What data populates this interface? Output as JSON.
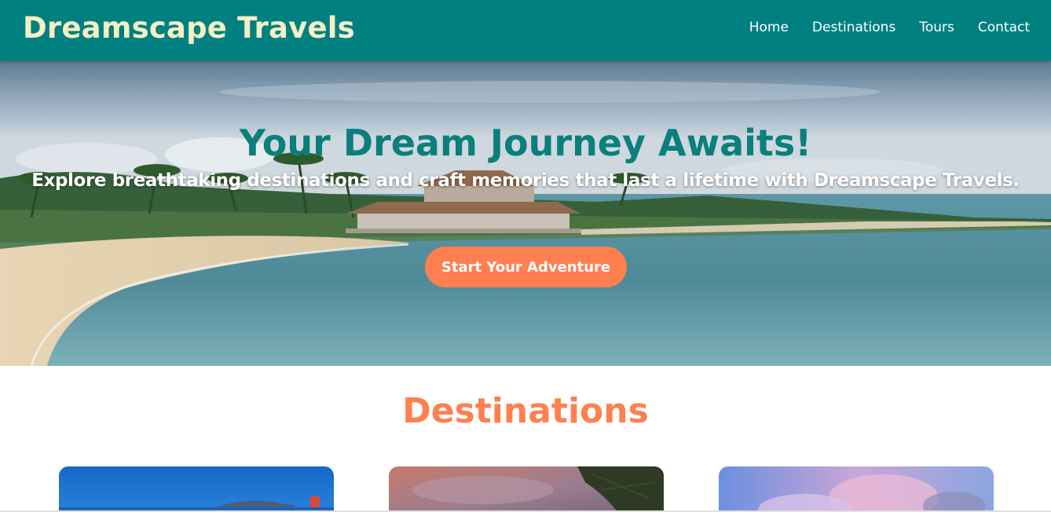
{
  "brand": {
    "name": "Dreamscape Travels"
  },
  "nav": {
    "items": [
      "Home",
      "Destinations",
      "Tours",
      "Contact"
    ]
  },
  "hero": {
    "title": "Your Dream Journey Awaits!",
    "subtitle": "Explore breathtaking destinations and craft memories that last a lifetime with Dreamscape Travels.",
    "cta_label": "Start Your Adventure"
  },
  "destinations": {
    "title": "Destinations",
    "cards": [
      "coastal-island-image",
      "sunset-pine-image",
      "pink-clouds-image"
    ]
  },
  "colors": {
    "header_bg": "#00807f",
    "brand_text": "#f5efc6",
    "accent": "#ff7f50",
    "hero_title": "#0a7f7c"
  }
}
